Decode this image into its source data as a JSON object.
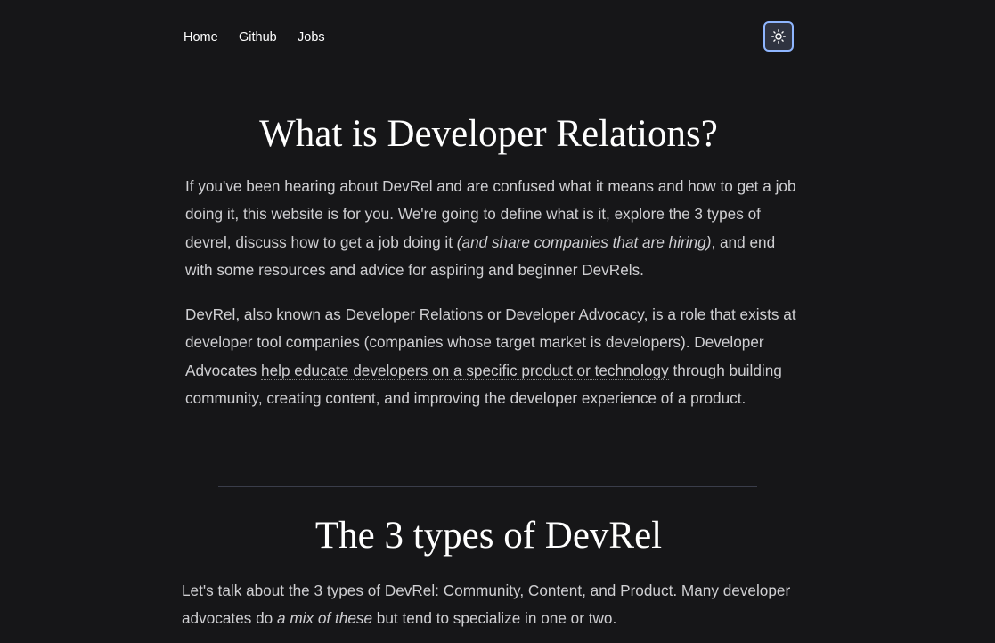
{
  "nav": {
    "home": "Home",
    "github": "Github",
    "jobs": "Jobs",
    "theme_toggle_icon": "sun-icon"
  },
  "section1": {
    "title": "What is Developer Relations?",
    "p1_a": "If you've been hearing about DevRel and are confused what it means and how to get a job doing it, this website is for you. We're going to define what is it, explore the 3 types of devrel, discuss how to get a job doing it ",
    "p1_em": "(and share companies that are hiring)",
    "p1_b": ", and end with some resources and advice for aspiring and beginner DevRels.",
    "p2_a": "DevRel, also known as Developer Relations or Developer Advocacy, is a role that exists at developer tool companies (companies whose target market is developers). Developer Advocates ",
    "p2_link": "help educate developers on a specific product or technology",
    "p2_b": " through building community, creating content, and improving the developer experience of a product."
  },
  "section2": {
    "title": "The 3 types of DevRel",
    "p3_a": "Let's talk about the 3 types of DevRel: Community, Content, and Product. Many developer advocates do ",
    "p3_em": "a mix of these",
    "p3_b": " but tend to specialize in one or two."
  },
  "colors": {
    "background": "#161618",
    "accent_border": "#8fb6ff",
    "divider": "#3a3d4a"
  }
}
